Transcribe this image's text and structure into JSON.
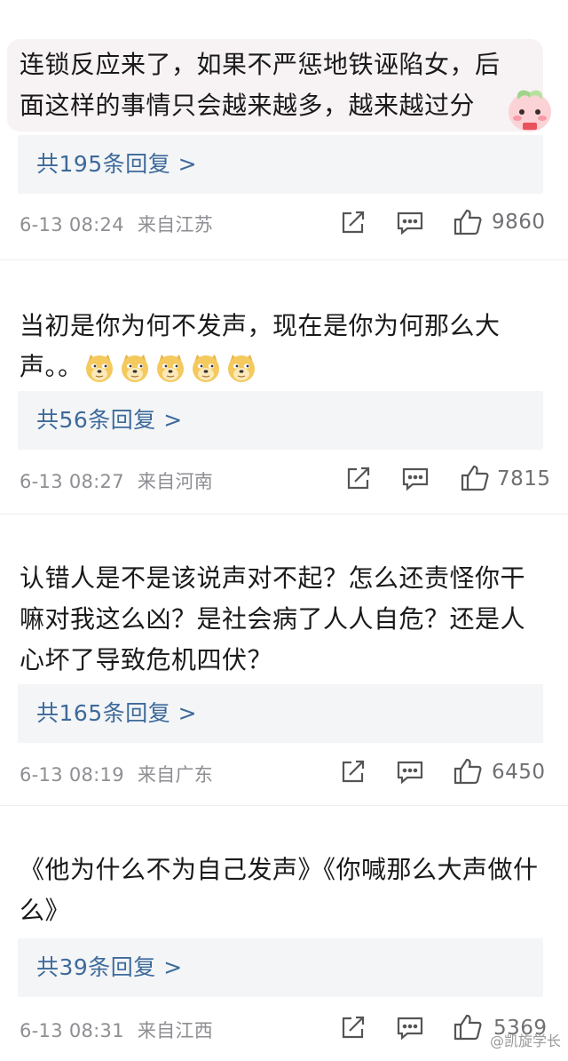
{
  "comments": [
    {
      "text": "连锁反应来了，如果不严惩地铁诬陷女，后面这样的事情只会越来越多，越来越过分",
      "replies": "共195条回复 >",
      "time": "6-13 08:24",
      "location": "来自江苏",
      "likes": "9860"
    },
    {
      "text": "当初是你为何不发声，现在是你为何那么大声。。",
      "emoji_count": 5,
      "replies": "共56条回复 >",
      "time": "6-13 08:27",
      "location": "来自河南",
      "likes": "7815"
    },
    {
      "text": "认错人是不是该说声对不起？怎么还责怪你干嘛对我这么凶？是社会病了人人自危？还是人心坏了导致危机四伏？",
      "replies": "共165条回复 >",
      "time": "6-13 08:19",
      "location": "来自广东",
      "likes": "6450"
    },
    {
      "text": "《他为什么不为自己发声》《你喊那么大声做什么》",
      "replies": "共39条回复 >",
      "time": "6-13 08:31",
      "location": "来自江西",
      "likes": "5369"
    }
  ],
  "watermark": "@凯旋学长",
  "icons": {
    "share": "share-icon",
    "comment": "comment-icon",
    "like": "thumbs-up-icon",
    "emoji": "doge-emoji-icon",
    "sticker": "peach-sticker-icon"
  },
  "colors": {
    "reply_link": "#3d6a9a",
    "meta_text": "#8e8e93",
    "reply_bg": "#f4f5f7",
    "bubble_bg": "#f7f2f4"
  }
}
